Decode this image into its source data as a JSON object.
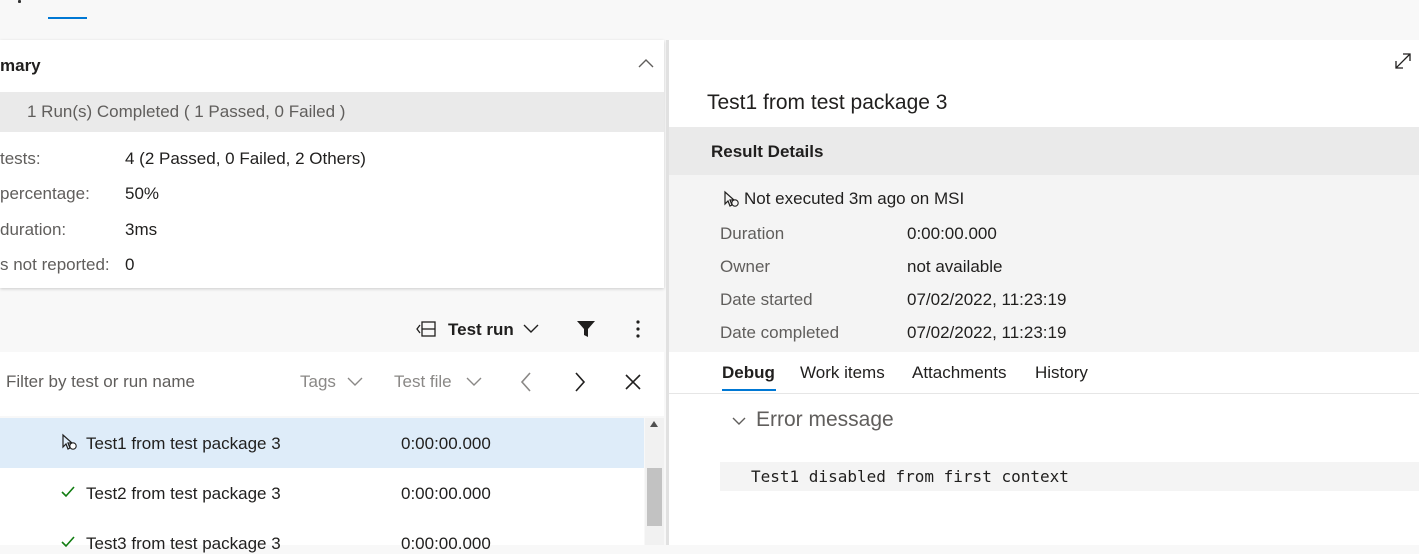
{
  "summary": {
    "title": "mary",
    "band": "1 Run(s) Completed ( 1 Passed, 0 Failed )",
    "stats": [
      {
        "label": "tests:",
        "value": "4 (2 Passed, 0 Failed, 2 Others)"
      },
      {
        "label": "percentage:",
        "value": "50%"
      },
      {
        "label": "duration:",
        "value": "3ms"
      },
      {
        "label": "s not reported:",
        "value": "0"
      }
    ]
  },
  "toolbar": {
    "groupby_label": "Test run"
  },
  "filter": {
    "placeholder": "Filter by test or run name",
    "tags_label": "Tags",
    "testfile_label": "Test file"
  },
  "results": [
    {
      "name": "Test1 from test package 3",
      "duration": "0:00:00.000",
      "status": "not-executed"
    },
    {
      "name": "Test2 from test package 3",
      "duration": "0:00:00.000",
      "status": "passed"
    },
    {
      "name": "Test3 from test package 3",
      "duration": "0:00:00.000",
      "status": "passed"
    }
  ],
  "detail": {
    "title": "Test1 from test package 3",
    "section_title": "Result Details",
    "status_line": "Not executed 3m ago on MSI",
    "fields": [
      {
        "label": "Duration",
        "value": "0:00:00.000"
      },
      {
        "label": "Owner",
        "value": "not available"
      },
      {
        "label": "Date started",
        "value": "07/02/2022, 11:23:19"
      },
      {
        "label": "Date completed",
        "value": "07/02/2022, 11:23:19"
      }
    ],
    "tabs": [
      "Debug",
      "Work items",
      "Attachments",
      "History"
    ],
    "error_title": "Error message",
    "error_text": "Test1 disabled from first context"
  },
  "colors": {
    "accent": "#0078d4",
    "selected_row": "#deecf9",
    "passed": "#107c10"
  }
}
